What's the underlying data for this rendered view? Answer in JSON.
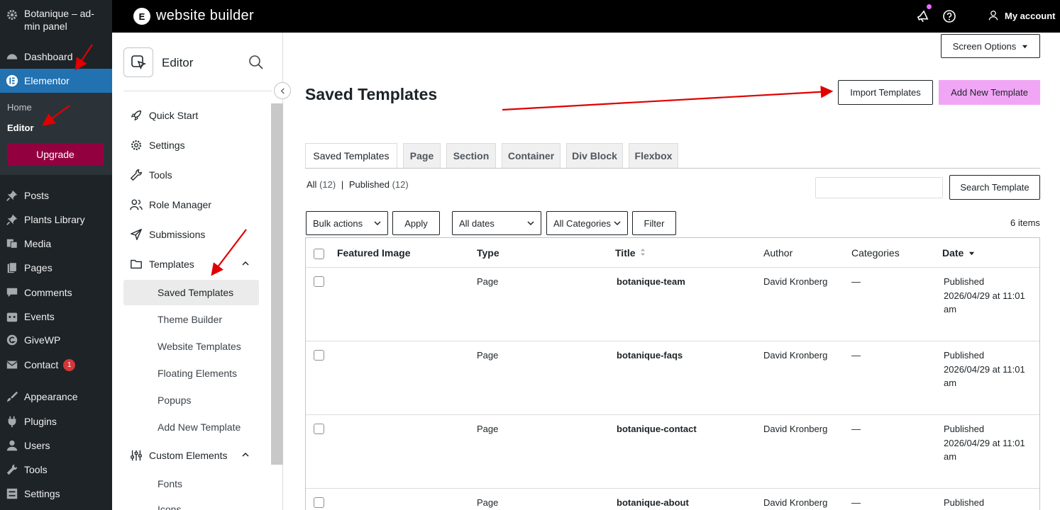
{
  "wp_sidebar": {
    "site_name": "Botanique – ad-min panel",
    "items": [
      {
        "label": "Dashboard",
        "icon": "dashboard-icon"
      },
      {
        "label": "Elementor",
        "icon": "elementor-icon"
      },
      {
        "label": "Posts",
        "icon": "pin-icon"
      },
      {
        "label": "Plants Library",
        "icon": "pin-icon"
      },
      {
        "label": "Media",
        "icon": "media-icon"
      },
      {
        "label": "Pages",
        "icon": "pages-icon"
      },
      {
        "label": "Comments",
        "icon": "comments-icon"
      },
      {
        "label": "Events",
        "icon": "calendar-icon"
      },
      {
        "label": "GiveWP",
        "icon": "givewp-icon"
      },
      {
        "label": "Contact",
        "icon": "mail-icon",
        "badge": "1"
      },
      {
        "label": "Appearance",
        "icon": "brush-icon"
      },
      {
        "label": "Plugins",
        "icon": "plugin-icon"
      },
      {
        "label": "Users",
        "icon": "users-icon"
      },
      {
        "label": "Tools",
        "icon": "wrench-icon"
      },
      {
        "label": "Settings",
        "icon": "settings-icon"
      }
    ],
    "submenu": {
      "home": "Home",
      "editor": "Editor",
      "upgrade": "Upgrade"
    }
  },
  "topbar": {
    "title": "website builder",
    "account": "My account",
    "logo_letter": "E"
  },
  "panel": {
    "title": "Editor",
    "menu": {
      "quick_start": "Quick Start",
      "settings": "Settings",
      "tools": "Tools",
      "role_manager": "Role Manager",
      "submissions": "Submissions",
      "templates": "Templates",
      "custom_elements": "Custom Elements"
    },
    "templates_sub": [
      "Saved Templates",
      "Theme Builder",
      "Website Templates",
      "Floating Elements",
      "Popups",
      "Add New Template"
    ],
    "custom_sub": [
      "Fonts",
      "Icons"
    ]
  },
  "main": {
    "screen_options": "Screen Options",
    "page_title": "Saved Templates",
    "import_btn": "Import Templates",
    "add_new_btn": "Add New Template",
    "tabs": [
      "Saved Templates",
      "Page",
      "Section",
      "Container",
      "Div Block",
      "Flexbox"
    ],
    "status": {
      "all": "All",
      "all_count": "(12)",
      "sep": "|",
      "published": "Published",
      "published_count": "(12)"
    },
    "search_btn": "Search Template",
    "bulk_actions": "Bulk actions",
    "apply": "Apply",
    "all_dates": "All dates",
    "all_categories": "All Categories",
    "filter": "Filter",
    "items_count": "6 items",
    "columns": {
      "featured_image": "Featured Image",
      "type": "Type",
      "title": "Title",
      "author": "Author",
      "categories": "Categories",
      "date": "Date"
    },
    "rows": [
      {
        "type": "Page",
        "title": "botanique-team",
        "author": "David Kronberg",
        "categories": "—",
        "date_status": "Published",
        "date_line1": "2026/04/29 at 11:01",
        "date_line2": "am"
      },
      {
        "type": "Page",
        "title": "botanique-faqs",
        "author": "David Kronberg",
        "categories": "—",
        "date_status": "Published",
        "date_line1": "2026/04/29 at 11:01",
        "date_line2": "am"
      },
      {
        "type": "Page",
        "title": "botanique-contact",
        "author": "David Kronberg",
        "categories": "—",
        "date_status": "Published",
        "date_line1": "2026/04/29 at 11:01",
        "date_line2": "am"
      },
      {
        "type": "Page",
        "title": "botanique-about",
        "author": "David Kronberg",
        "categories": "—",
        "date_status": "Published",
        "date_line1": "",
        "date_line2": ""
      }
    ]
  },
  "colors": {
    "wp_dark": "#1d2327",
    "wp_blue": "#2271b1",
    "upgrade": "#93003f",
    "add_new": "#f0a6f5",
    "annotation_arrow": "#e00000"
  }
}
